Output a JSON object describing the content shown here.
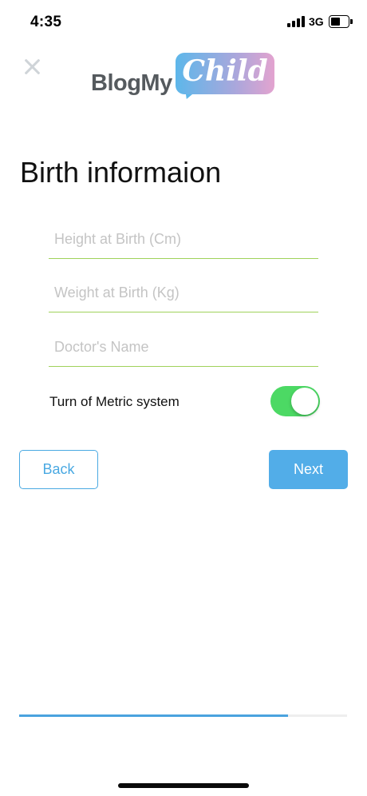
{
  "status_bar": {
    "time": "4:35",
    "network": "3G",
    "signal_icon": "cellular-signal-icon",
    "battery_icon": "battery-icon"
  },
  "header": {
    "close_icon": "close-icon",
    "logo_text": "BlogMy",
    "logo_script": "Child"
  },
  "page": {
    "title": "Birth informaion"
  },
  "form": {
    "height_placeholder": "Height at Birth (Cm)",
    "weight_placeholder": "Weight at Birth (Kg)",
    "doctor_placeholder": "Doctor's Name",
    "height_value": "",
    "weight_value": "",
    "doctor_value": "",
    "toggle_label": "Turn of Metric system",
    "toggle_on": true
  },
  "actions": {
    "back_label": "Back",
    "next_label": "Next"
  },
  "progress": {
    "fraction": 0.82
  },
  "colors": {
    "accent": "#52ade8",
    "field_underline": "#9fd25b",
    "toggle_on": "#4cd964",
    "logo_gradient_start": "#5db7ea",
    "logo_gradient_end": "#e3a3cf"
  }
}
